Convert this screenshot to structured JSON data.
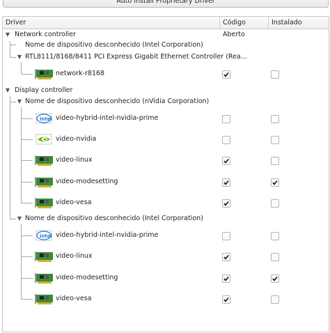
{
  "top_button": "Auto Install Proprietary Driver",
  "columns": {
    "driver": "Driver",
    "open_source": "Código Aberto",
    "installed": "Instalado"
  },
  "tree": {
    "network_controller": {
      "label": "Network controller",
      "device1": "Nome de dispositivo desconhecido (Intel Corporation)",
      "device2": "RTL8111/8168/8411 PCI Express Gigabit Ethernet Controller (Rea…",
      "driver1": {
        "name": "network-r8168",
        "icon": "pci-card-icon",
        "open_source": true,
        "installed": false
      }
    },
    "display_controller": {
      "label": "Display controller",
      "nvidia_device": {
        "label": "Nome de dispositivo desconhecido (nVidia Corporation)",
        "drivers": [
          {
            "name": "video-hybrid-intel-nvidia-prime",
            "icon": "intel-logo-icon",
            "open_source": false,
            "installed": false
          },
          {
            "name": "video-nvidia",
            "icon": "nvidia-logo-icon",
            "open_source": false,
            "installed": false
          },
          {
            "name": "video-linux",
            "icon": "pci-card-icon",
            "open_source": true,
            "installed": false
          },
          {
            "name": "video-modesetting",
            "icon": "pci-card-icon",
            "open_source": true,
            "installed": true
          },
          {
            "name": "video-vesa",
            "icon": "pci-card-icon",
            "open_source": true,
            "installed": false
          }
        ]
      },
      "intel_device": {
        "label": "Nome de dispositivo desconhecido (Intel Corporation)",
        "drivers": [
          {
            "name": "video-hybrid-intel-nvidia-prime",
            "icon": "intel-logo-icon",
            "open_source": false,
            "installed": false
          },
          {
            "name": "video-linux",
            "icon": "pci-card-icon",
            "open_source": true,
            "installed": false
          },
          {
            "name": "video-modesetting",
            "icon": "pci-card-icon",
            "open_source": true,
            "installed": true
          },
          {
            "name": "video-vesa",
            "icon": "pci-card-icon",
            "open_source": true,
            "installed": false
          }
        ]
      }
    }
  }
}
